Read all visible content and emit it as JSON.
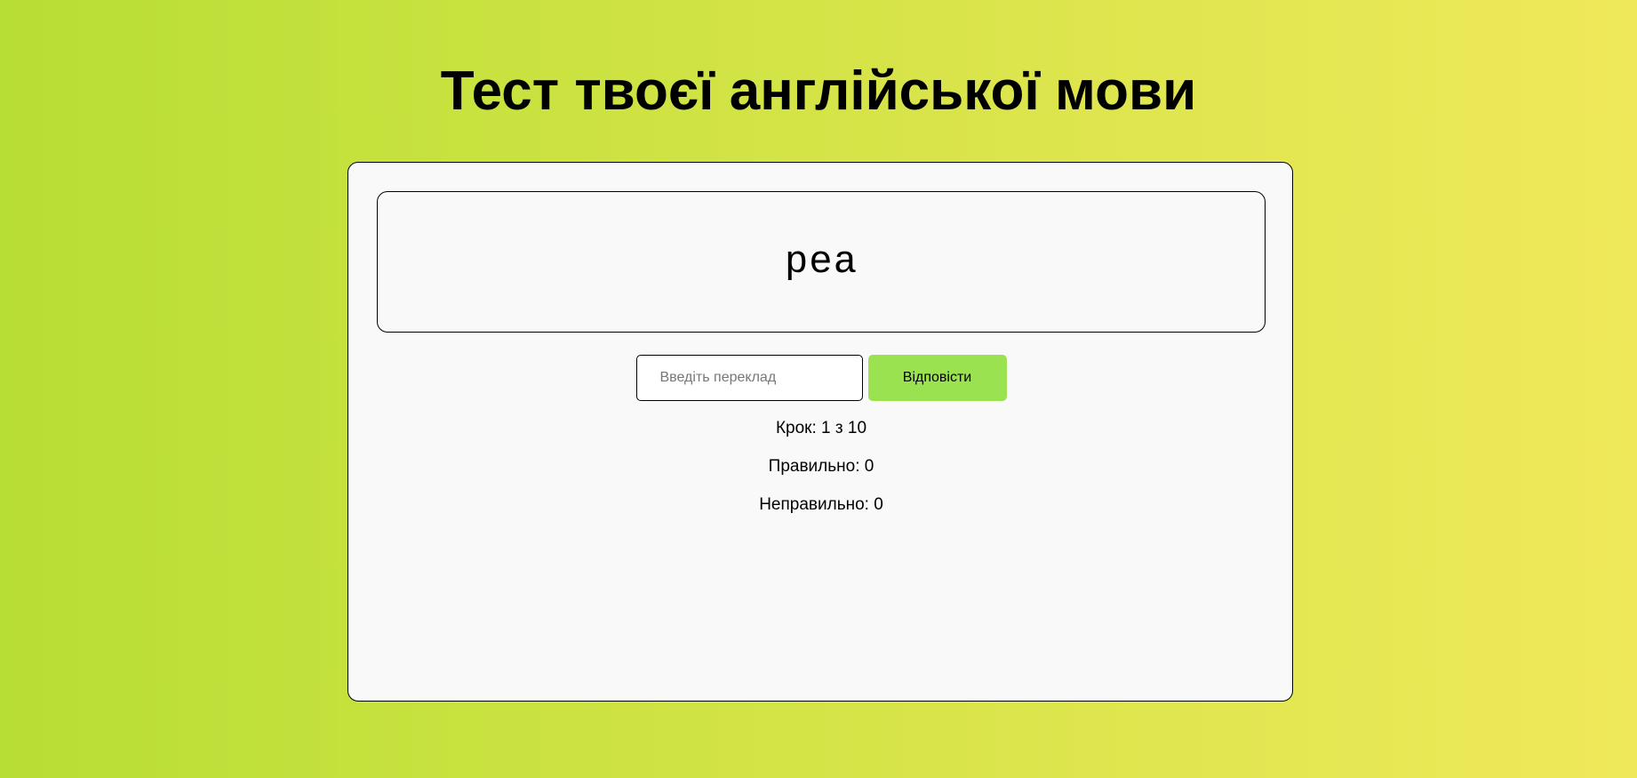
{
  "header": {
    "title": "Тест твоєї англійської мови"
  },
  "quiz": {
    "word": "pea",
    "input": {
      "value": "",
      "placeholder": "Введіть переклад"
    },
    "submit_label": "Відповісти",
    "step": {
      "label": "Крок:",
      "current": 1,
      "separator": "з",
      "total": 10
    },
    "correct": {
      "label": "Правильно:",
      "count": 0
    },
    "wrong": {
      "label": "Неправильно:",
      "count": 0
    }
  },
  "colors": {
    "background_start": "#b7de35",
    "background_end": "#efe95a",
    "card_background": "#f9f9f9",
    "button_accent": "#9be251"
  }
}
